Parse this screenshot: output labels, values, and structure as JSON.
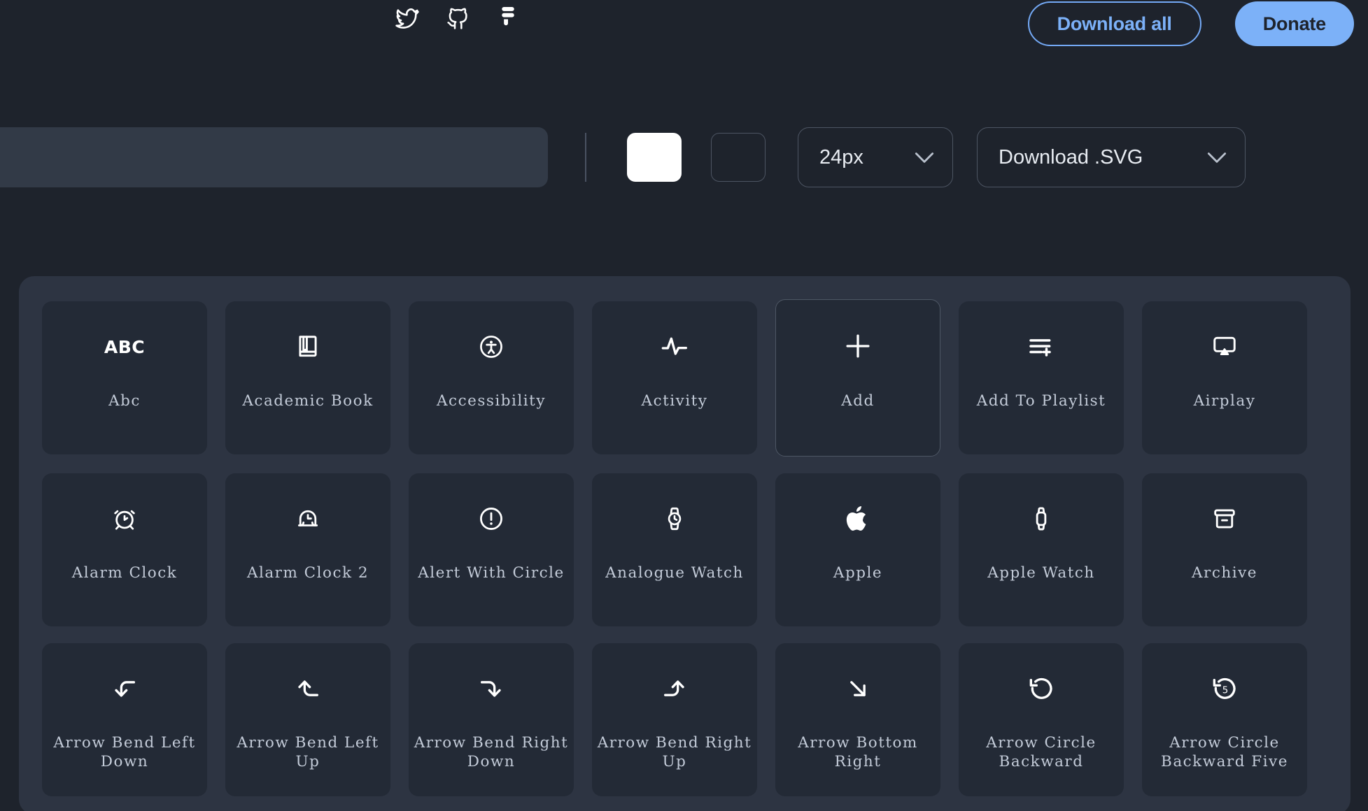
{
  "topbar": {
    "social": [
      {
        "name": "twitter-icon",
        "label": "Twitter"
      },
      {
        "name": "github-icon",
        "label": "GitHub"
      },
      {
        "name": "figma-icon",
        "label": "Figma"
      }
    ],
    "download_all_label": "Download all",
    "donate_label": "Donate",
    "accent_blue": "#7cb1f8"
  },
  "toolbar": {
    "search_value": "",
    "search_placeholder": "",
    "color_swatches": [
      {
        "name": "color-swatch-white",
        "color": "#ffffff",
        "selected": true
      },
      {
        "name": "color-swatch-dark",
        "color": "#232a36",
        "selected": false
      }
    ],
    "size_select": {
      "value": "24px"
    },
    "format_select": {
      "value": "Download .SVG"
    }
  },
  "icon_grid": {
    "columns": 7,
    "icons": [
      {
        "label": "Abc",
        "icon": "abc-icon",
        "hovered": false
      },
      {
        "label": "Academic Book",
        "icon": "academic-book-icon",
        "hovered": false
      },
      {
        "label": "Accessibility",
        "icon": "accessibility-icon",
        "hovered": false
      },
      {
        "label": "Activity",
        "icon": "activity-icon",
        "hovered": false
      },
      {
        "label": "Add",
        "icon": "add-icon",
        "hovered": true
      },
      {
        "label": "Add To Playlist",
        "icon": "add-to-playlist-icon",
        "hovered": false
      },
      {
        "label": "Airplay",
        "icon": "airplay-icon",
        "hovered": false
      },
      {
        "label": "Alarm Clock",
        "icon": "alarm-clock-icon",
        "hovered": false
      },
      {
        "label": "Alarm Clock 2",
        "icon": "alarm-clock-2-icon",
        "hovered": false
      },
      {
        "label": "Alert With Circle",
        "icon": "alert-with-circle-icon",
        "hovered": false
      },
      {
        "label": "Analogue Watch",
        "icon": "analogue-watch-icon",
        "hovered": false
      },
      {
        "label": "Apple",
        "icon": "apple-icon",
        "hovered": false
      },
      {
        "label": "Apple Watch",
        "icon": "apple-watch-icon",
        "hovered": false
      },
      {
        "label": "Archive",
        "icon": "archive-icon",
        "hovered": false
      },
      {
        "label": "Arrow Bend Left Down",
        "icon": "arrow-bend-left-down-icon",
        "hovered": false
      },
      {
        "label": "Arrow Bend Left Up",
        "icon": "arrow-bend-left-up-icon",
        "hovered": false
      },
      {
        "label": "Arrow Bend Right Down",
        "icon": "arrow-bend-right-down-icon",
        "hovered": false
      },
      {
        "label": "Arrow Bend Right Up",
        "icon": "arrow-bend-right-up-icon",
        "hovered": false
      },
      {
        "label": "Arrow Bottom Right",
        "icon": "arrow-bottom-right-icon",
        "hovered": false
      },
      {
        "label": "Arrow Circle Backward",
        "icon": "arrow-circle-backward-icon",
        "hovered": false
      },
      {
        "label": "Arrow Circle Backward Five",
        "icon": "arrow-circle-backward-five-icon",
        "hovered": false,
        "badge": "5"
      }
    ]
  },
  "theme": {
    "page_bg": "#1e232c",
    "panel_bg": "#2d3442",
    "card_bg": "#232a36",
    "label_color": "#c3cbd8",
    "icon_color": "#ffffff"
  }
}
